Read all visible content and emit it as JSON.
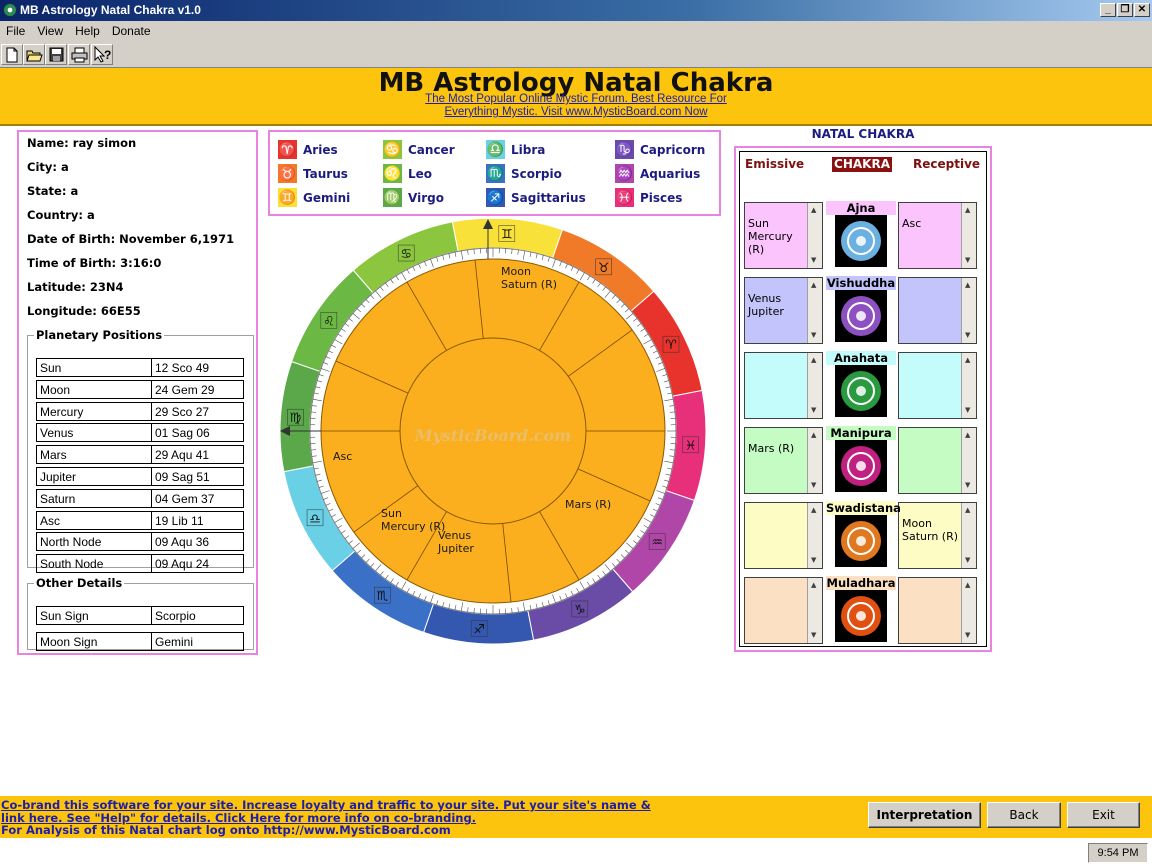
{
  "window": {
    "title": "MB Astrology Natal Chakra v1.0"
  },
  "menu": [
    "File",
    "View",
    "Help",
    "Donate"
  ],
  "toolbar": {
    "buttons": [
      "new-file-icon",
      "open-folder-icon",
      "save-disk-icon",
      "print-icon",
      "context-help-icon"
    ]
  },
  "header": {
    "title": "MB Astrology Natal Chakra",
    "tagline_1": "The Most Popular Online Mystic Forum. Best Resource For",
    "tagline_2": "Everything Mystic. Visit www.MysticBoard.com Now"
  },
  "person": {
    "name": "Name: ray simon",
    "city": "City: a",
    "state": "State: a",
    "country": "Country: a",
    "dob": "Date of Birth: November 6,1971",
    "tob": "Time of Birth: 3:16:0",
    "lat": "Latitude: 23N4",
    "lon": "Longitude: 66E55"
  },
  "planetary": {
    "legend": "Planetary Positions",
    "rows": [
      [
        "Sun",
        "12 Sco 49"
      ],
      [
        "Moon",
        "24 Gem 29"
      ],
      [
        "Mercury",
        "29 Sco 27"
      ],
      [
        "Venus",
        "01 Sag 06"
      ],
      [
        "Mars",
        "29 Aqu 41"
      ],
      [
        "Jupiter",
        "09 Sag 51"
      ],
      [
        "Saturn",
        "04 Gem 37"
      ],
      [
        "Asc",
        "19 Lib 11"
      ],
      [
        "North Node",
        "09 Aqu 36"
      ],
      [
        "South Node",
        "09 Aqu 24"
      ]
    ]
  },
  "other": {
    "legend": "Other Details",
    "rows": [
      [
        "Sun Sign",
        "Scorpio"
      ],
      [
        "Moon Sign",
        "Gemini"
      ]
    ]
  },
  "signs": [
    {
      "name": "Aries",
      "glyph": "♈",
      "color": "#e8322c"
    },
    {
      "name": "Taurus",
      "glyph": "♉",
      "color": "#f07a28"
    },
    {
      "name": "Gemini",
      "glyph": "♊",
      "color": "#f8e23a"
    },
    {
      "name": "Cancer",
      "glyph": "♋",
      "color": "#8cc63e"
    },
    {
      "name": "Leo",
      "glyph": "♌",
      "color": "#6cb844"
    },
    {
      "name": "Virgo",
      "glyph": "♍",
      "color": "#5aa84a"
    },
    {
      "name": "Libra",
      "glyph": "♎",
      "color": "#6ad0e6"
    },
    {
      "name": "Scorpio",
      "glyph": "♏",
      "color": "#3a70c6"
    },
    {
      "name": "Sagittarius",
      "glyph": "♐",
      "color": "#3458b0"
    },
    {
      "name": "Capricorn",
      "glyph": "♑",
      "color": "#6a4ca6"
    },
    {
      "name": "Aquarius",
      "glyph": "♒",
      "color": "#b046a8"
    },
    {
      "name": "Pisces",
      "glyph": "♓",
      "color": "#e8307a"
    }
  ],
  "wheel": {
    "house_labels": {
      "moon_saturn": [
        "Moon",
        "Saturn (R)"
      ],
      "asc": [
        "Asc"
      ],
      "sun_mercury": [
        "Sun",
        "Mercury (R)"
      ],
      "venus_jupiter": [
        "Venus",
        "Jupiter"
      ],
      "mars": [
        "Mars (R)"
      ]
    },
    "watermark": "MysticBoard.com"
  },
  "chakra": {
    "title": "NATAL CHAKRA",
    "emissive": "Emissive",
    "center": "CHAKRA",
    "receptive": "Receptive",
    "rows": [
      {
        "name": "Ajna",
        "emissive": "Sun\nMercury\n(R)",
        "receptive": "Asc",
        "color": "#fcc4fc"
      },
      {
        "name": "Vishuddha",
        "emissive": "Venus\nJupiter",
        "receptive": "",
        "color": "#c4c4fc"
      },
      {
        "name": "Anahata",
        "emissive": "",
        "receptive": "",
        "color": "#c4fcfc"
      },
      {
        "name": "Manipura",
        "emissive": "Mars (R)",
        "receptive": "",
        "color": "#c4fcc4"
      },
      {
        "name": "Swadistana",
        "emissive": "",
        "receptive": "Moon\nSaturn (R)",
        "color": "#fcfcc4"
      },
      {
        "name": "Muladhara",
        "emissive": "",
        "receptive": "",
        "color": "#fce0c4"
      }
    ]
  },
  "footer": {
    "line_1": "Co-brand this software for your site.  Increase loyalty and traffic to your site. Put your site's name &",
    "line_2": "link here. See \"Help\" for details.    Click Here for more info on co-branding.",
    "line_3": "For Analysis of this Natal chart log onto http://www.MysticBoard.com",
    "interpretation": "Interpretation",
    "back": "Back",
    "exit": "Exit"
  },
  "clock": "9:54 PM"
}
